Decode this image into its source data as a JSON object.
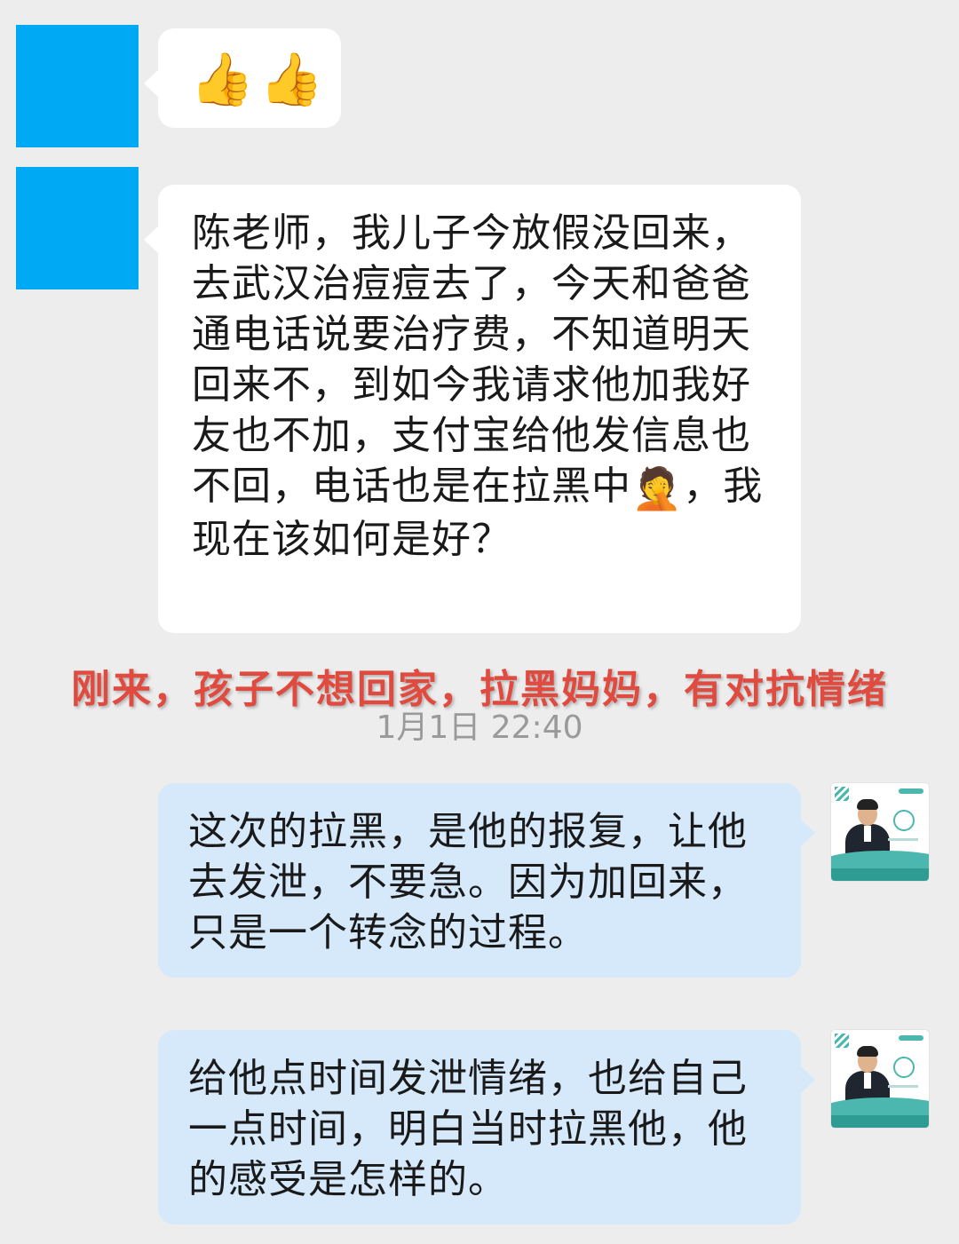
{
  "conversation": {
    "messages": [
      {
        "side": "left",
        "type": "emoji",
        "emojis": [
          "👍",
          "👍"
        ]
      },
      {
        "side": "left",
        "text_before": "陈老师，我儿子今放假没回来，去武汉治痘痘去了，今天和爸爸通电话说要治疗费，不知道明天回来不，到如今我请求他加我好友也不加，支付宝给他发信息也不回，电话也是在拉黑中",
        "emoji": "🤦",
        "text_after": "，我现在该如何是好？"
      },
      {
        "side": "right",
        "text": "这次的拉黑，是他的报复，让他去发泄，不要急。因为加回来，只是一个转念的过程。"
      },
      {
        "side": "right",
        "text": "给他点时间发泄情绪，也给自己一点时间，明白当时拉黑他，他的感受是怎样的。"
      }
    ],
    "annotation": "刚来，孩子不想回家，拉黑妈妈，有对抗情绪",
    "timestamp": "1月1日  22:40"
  },
  "colors": {
    "background": "#ededed",
    "left_avatar": "#00a9f4",
    "left_bubble": "#ffffff",
    "right_bubble": "#d6e9fb",
    "annotation": "#e04a3f",
    "timestamp": "#9a9a9a"
  },
  "icons": {
    "thumbs_up": "thumbs-up-icon",
    "facepalm": "facepalm-icon"
  }
}
